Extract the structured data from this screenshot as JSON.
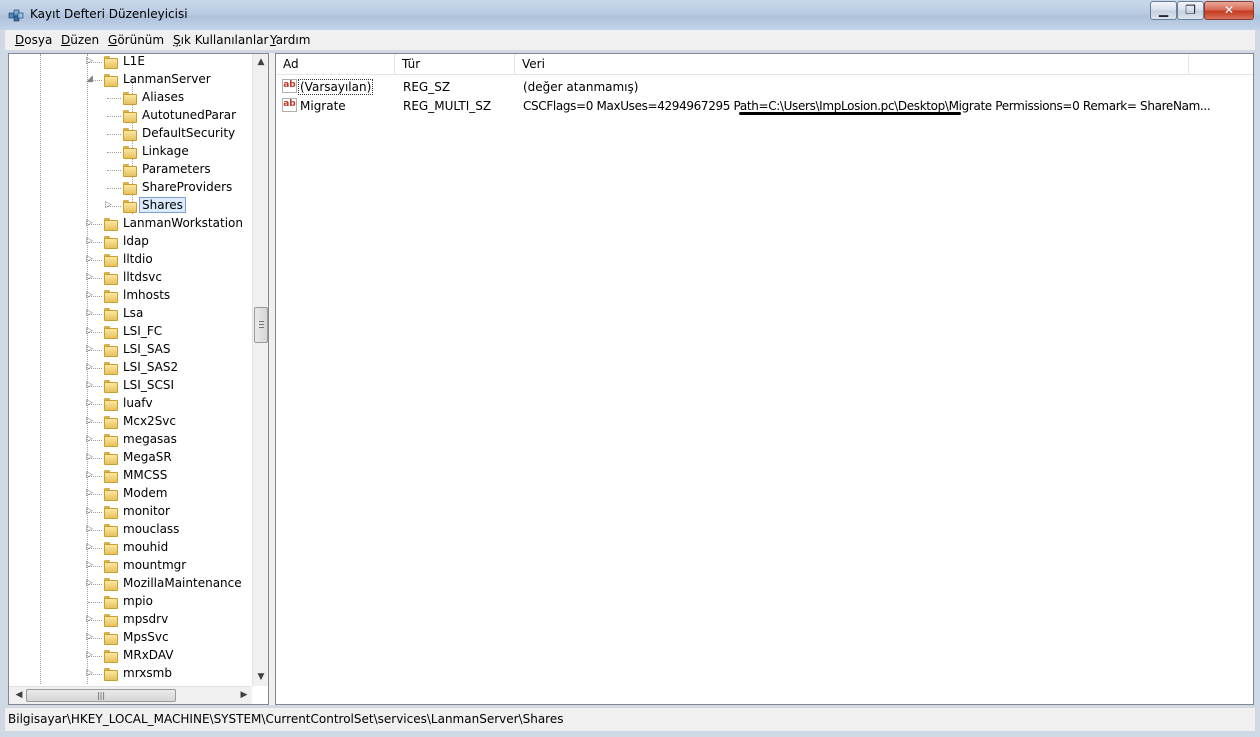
{
  "window": {
    "title": "Kayıt Defteri Düzenleyicisi"
  },
  "menu": [
    {
      "acc": "D",
      "rest": "osya"
    },
    {
      "acc": "D",
      "rest": "üzen"
    },
    {
      "acc": "G",
      "rest": "örünüm"
    },
    {
      "acc": "Ş",
      "rest": "ık Kullanılanlar"
    },
    {
      "acc": "Y",
      "rest": "ardım"
    }
  ],
  "tree": {
    "items": [
      {
        "label": "L1E",
        "depth": 0,
        "state": "collapsed"
      },
      {
        "label": "LanmanServer",
        "depth": 0,
        "state": "expanded"
      },
      {
        "label": "Aliases",
        "depth": 1,
        "state": "leaf"
      },
      {
        "label": "AutotunedParar",
        "depth": 1,
        "state": "leaf"
      },
      {
        "label": "DefaultSecurity",
        "depth": 1,
        "state": "leaf"
      },
      {
        "label": "Linkage",
        "depth": 1,
        "state": "leaf"
      },
      {
        "label": "Parameters",
        "depth": 1,
        "state": "leaf"
      },
      {
        "label": "ShareProviders",
        "depth": 1,
        "state": "leaf"
      },
      {
        "label": "Shares",
        "depth": 1,
        "state": "collapsed",
        "selected": true
      },
      {
        "label": "LanmanWorkstation",
        "depth": 0,
        "state": "collapsed"
      },
      {
        "label": "ldap",
        "depth": 0,
        "state": "collapsed"
      },
      {
        "label": "lltdio",
        "depth": 0,
        "state": "collapsed"
      },
      {
        "label": "lltdsvc",
        "depth": 0,
        "state": "collapsed"
      },
      {
        "label": "lmhosts",
        "depth": 0,
        "state": "collapsed"
      },
      {
        "label": "Lsa",
        "depth": 0,
        "state": "collapsed"
      },
      {
        "label": "LSI_FC",
        "depth": 0,
        "state": "collapsed"
      },
      {
        "label": "LSI_SAS",
        "depth": 0,
        "state": "collapsed"
      },
      {
        "label": "LSI_SAS2",
        "depth": 0,
        "state": "collapsed"
      },
      {
        "label": "LSI_SCSI",
        "depth": 0,
        "state": "collapsed"
      },
      {
        "label": "luafv",
        "depth": 0,
        "state": "collapsed"
      },
      {
        "label": "Mcx2Svc",
        "depth": 0,
        "state": "collapsed"
      },
      {
        "label": "megasas",
        "depth": 0,
        "state": "collapsed"
      },
      {
        "label": "MegaSR",
        "depth": 0,
        "state": "collapsed"
      },
      {
        "label": "MMCSS",
        "depth": 0,
        "state": "collapsed"
      },
      {
        "label": "Modem",
        "depth": 0,
        "state": "collapsed"
      },
      {
        "label": "monitor",
        "depth": 0,
        "state": "collapsed"
      },
      {
        "label": "mouclass",
        "depth": 0,
        "state": "collapsed"
      },
      {
        "label": "mouhid",
        "depth": 0,
        "state": "collapsed"
      },
      {
        "label": "mountmgr",
        "depth": 0,
        "state": "collapsed"
      },
      {
        "label": "MozillaMaintenance",
        "depth": 0,
        "state": "collapsed"
      },
      {
        "label": "mpio",
        "depth": 0,
        "state": "leaf"
      },
      {
        "label": "mpsdrv",
        "depth": 0,
        "state": "collapsed"
      },
      {
        "label": "MpsSvc",
        "depth": 0,
        "state": "collapsed"
      },
      {
        "label": "MRxDAV",
        "depth": 0,
        "state": "collapsed"
      },
      {
        "label": "mrxsmb",
        "depth": 0,
        "state": "collapsed"
      }
    ],
    "scroll_fraction": 0.4
  },
  "list": {
    "columns": [
      "Ad",
      "Tür",
      "Veri"
    ],
    "rows": [
      {
        "icon": "string-value-icon",
        "icon_text": "ab",
        "name": "(Varsayılan)",
        "type": "REG_SZ",
        "data": "(değer atanmamış)",
        "focused": true
      },
      {
        "icon": "string-value-icon",
        "icon_text": "ab",
        "name": "Migrate",
        "type": "REG_MULTI_SZ",
        "data": "CSCFlags=0 MaxUses=4294967295 Path=C:\\Users\\ImpLosion.pc\\Desktop\\Migrate Permissions=0 Remark= ShareNam..."
      }
    ]
  },
  "status": {
    "path": "Bilgisayar\\HKEY_LOCAL_MACHINE\\SYSTEM\\CurrentControlSet\\services\\LanmanServer\\Shares"
  },
  "colors": {
    "selection": "#dcebfc",
    "annotation": "#000000"
  }
}
